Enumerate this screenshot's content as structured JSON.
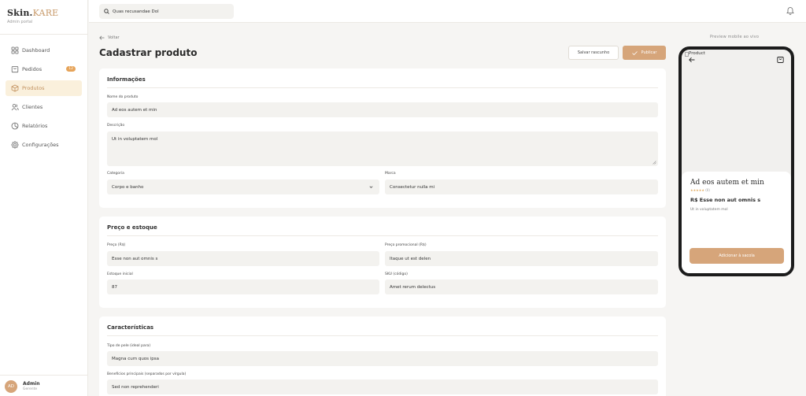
{
  "brand": {
    "name_main": "Skin.",
    "name_accent": "KARE",
    "subtitle": "Admin portal"
  },
  "nav": [
    {
      "label": "Dashboard",
      "icon": "dashboard-icon"
    },
    {
      "label": "Pedidos",
      "icon": "orders-icon",
      "badge": "12"
    },
    {
      "label": "Produtos",
      "icon": "product-icon",
      "active": true
    },
    {
      "label": "Clientes",
      "icon": "users-icon"
    },
    {
      "label": "Relatórios",
      "icon": "report-icon"
    },
    {
      "label": "Configurações",
      "icon": "settings-icon"
    }
  ],
  "user": {
    "initials": "AD",
    "name": "Admin",
    "role": "Gerente"
  },
  "search": {
    "value": "Quas recusandae Dol"
  },
  "header": {
    "back": "Voltar",
    "title": "Cadastrar produto",
    "draft": "Salvar rascunho",
    "publish": "Publicar"
  },
  "info": {
    "title": "Informações",
    "name_label": "Nome do produto",
    "name_value": "Ad eos autem et min",
    "desc_label": "Descrição",
    "desc_value": "Ut in voluptatem mol",
    "category_label": "Categoria",
    "category_value": "Corpo e banho",
    "brand_label": "Marca",
    "brand_value": "Consectetur nulla mi"
  },
  "pricing": {
    "title": "Preço e estoque",
    "price_label": "Preço (R$)",
    "price_value": "Esse non aut omnis s",
    "promo_label": "Preço promocional (R$)",
    "promo_value": "Itaque ut est delen",
    "stock_label": "Estoque inicial",
    "stock_value": "87",
    "sku_label": "SKU (código)",
    "sku_value": "Amet rerum delectus"
  },
  "features": {
    "title": "Características",
    "skin_label": "Tipo de pele (ideal para)",
    "skin_value": "Magna cum quos ipsa",
    "benefits_label": "Benefícios principais (separados por vírgula)",
    "benefits_value": "Sed non reprehenderi"
  },
  "preview": {
    "label": "Preview mobile ao vivo",
    "img_alt": "Product",
    "name": "Ad eos autem et min",
    "stars": "★★★★★",
    "reviews": "(0)",
    "price": "R$ Esse non aut omnis s",
    "desc": "Ut in voluptatem mol",
    "add_button": "Adicionar à sacola"
  },
  "colors": {
    "accent": "#d6a57a",
    "active_bg": "#faf0dc",
    "badge": "#e6a45a"
  }
}
